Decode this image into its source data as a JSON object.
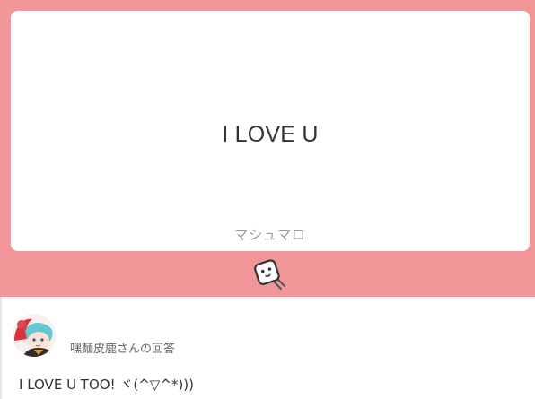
{
  "question": {
    "text": "I LOVE U"
  },
  "brand": {
    "name": "マシュマロ"
  },
  "mascot": {
    "icon": "marshmallow-mascot-icon"
  },
  "answer": {
    "answerer_label": "嘿麵皮鹿さんの回答",
    "text": "I LOVE U TOO! ヾ(^▽^*)))"
  },
  "colors": {
    "banner": "#f29799",
    "card": "#ffffff",
    "question_text": "#333333",
    "brand_text": "#9a9a9a",
    "answerer_text": "#666666"
  }
}
